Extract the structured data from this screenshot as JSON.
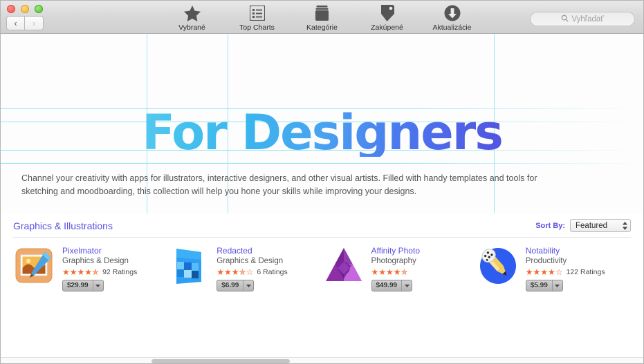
{
  "window": {
    "traffic_lights": [
      "close",
      "minimize",
      "zoom"
    ],
    "nav": {
      "back_label": "‹",
      "forward_label": "›",
      "forward_disabled": true
    }
  },
  "toolbar": {
    "items": [
      {
        "label": "Vybrané",
        "icon": "star-icon"
      },
      {
        "label": "Top Charts",
        "icon": "list-icon"
      },
      {
        "label": "Kategórie",
        "icon": "folder-icon"
      },
      {
        "label": "Zakúpené",
        "icon": "tag-icon"
      },
      {
        "label": "Aktualizácie",
        "icon": "download-arrow-icon"
      }
    ],
    "search": {
      "placeholder": "Vyhľadať",
      "value": "",
      "icon": "search-icon"
    }
  },
  "hero": {
    "title": "For Designers",
    "description": "Channel your creativity with apps for illustrators, interactive designers, and other visual artists. Filled with handy templates and tools for sketching and moodboarding, this collection will help you hone your skills while improving your designs.",
    "grid_color": "#8ee4f0",
    "gradient_start": "#93dff2",
    "gradient_end": "#6f5ad8"
  },
  "section": {
    "title": "Graphics & Illustrations",
    "sort_label": "Sort By:",
    "sort_value": "Featured",
    "link_color": "#5a4ee0"
  },
  "apps": [
    {
      "name": "Pixelmator",
      "category": "Graphics & Design",
      "stars": "★★★★✯",
      "rating_value": 4.5,
      "ratings": "92 Ratings",
      "price": "$29.99",
      "icon": "pixelmator-icon"
    },
    {
      "name": "Redacted",
      "category": "Graphics & Design",
      "stars": "★★★✯☆",
      "rating_value": 3.5,
      "ratings": "6 Ratings",
      "price": "$6.99",
      "icon": "redacted-icon"
    },
    {
      "name": "Affinity Photo",
      "category": "Photography",
      "stars": "★★★★✯",
      "rating_value": 4.5,
      "ratings": "",
      "price": "$49.99",
      "icon": "affinity-photo-icon"
    },
    {
      "name": "Notability",
      "category": "Productivity",
      "stars": "★★★★☆",
      "rating_value": 4,
      "ratings": "122 Ratings",
      "price": "$5.99",
      "icon": "notability-icon"
    }
  ]
}
